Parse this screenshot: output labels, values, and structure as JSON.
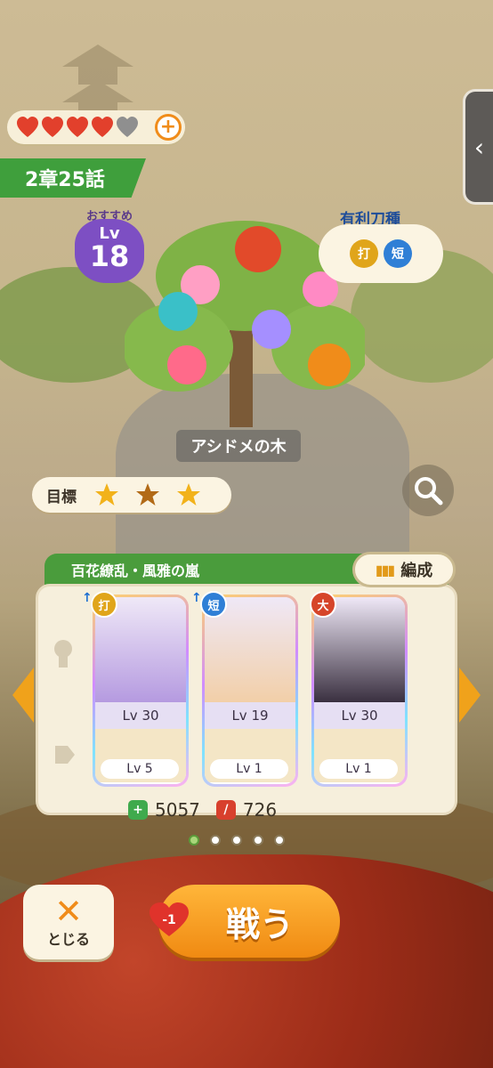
{
  "hud": {
    "hearts_full": 4,
    "hearts_total": 5,
    "add_label": "+",
    "side_tab_icon": "‹"
  },
  "stage": {
    "chapter": "2章25話",
    "recommended_label": "おすすめ",
    "lv_label": "Lv",
    "recommended_level": "18",
    "advantage_title": "有利刀種",
    "advantage_types": [
      "打",
      "短"
    ],
    "name": "アシドメの木",
    "goal_label": "目標",
    "goal_stars": 3
  },
  "team": {
    "name": "百花繚乱・風雅の嵐",
    "formation_label": "編成",
    "cards": [
      {
        "type": "打",
        "advantage": true,
        "lv": "Lv 30",
        "equip_lv": "Lv 5"
      },
      {
        "type": "短",
        "advantage": true,
        "lv": "Lv 19",
        "equip_lv": "Lv 1"
      },
      {
        "type": "大",
        "advantage": false,
        "lv": "Lv 30",
        "equip_lv": "Lv 1"
      }
    ],
    "hp": "5057",
    "attack": "726"
  },
  "pager": {
    "count": 5,
    "active": 0
  },
  "actions": {
    "close_icon": "✕",
    "close_label": "とじる",
    "fight_label": "戦う",
    "fight_cost": "-1"
  },
  "colors": {
    "accent_orange": "#f08c1a",
    "chapter_green": "#3f9f3c",
    "level_purple": "#7d4fc3"
  }
}
